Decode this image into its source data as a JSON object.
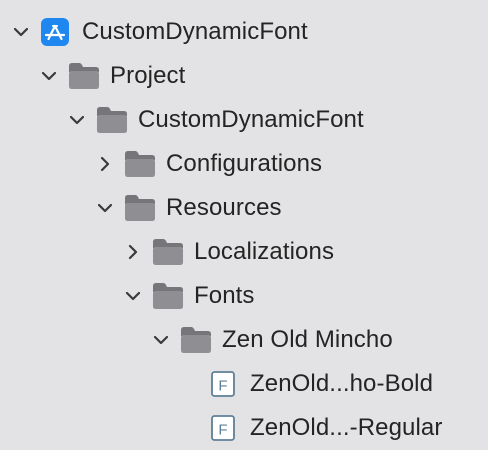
{
  "navigator": {
    "colors": {
      "folder": "#8e8e93",
      "folder_tab": "#75757a",
      "app_icon": "#1e87f0",
      "file_icon": "#5e7f96",
      "chevron": "#3a3a3c",
      "text": "#242424",
      "background": "#e3e3e5"
    },
    "items": [
      {
        "label": "CustomDynamicFont",
        "icon": "app-project-icon",
        "expanded": true
      },
      {
        "label": "Project",
        "icon": "folder-icon",
        "expanded": true
      },
      {
        "label": "CustomDynamicFont",
        "icon": "folder-icon",
        "expanded": true
      },
      {
        "label": "Configurations",
        "icon": "folder-icon",
        "expanded": false
      },
      {
        "label": "Resources",
        "icon": "folder-icon",
        "expanded": true
      },
      {
        "label": "Localizations",
        "icon": "folder-icon",
        "expanded": false
      },
      {
        "label": "Fonts",
        "icon": "folder-icon",
        "expanded": true
      },
      {
        "label": "Zen Old Mincho",
        "icon": "folder-icon",
        "expanded": true
      },
      {
        "label": "ZenOld...ho-Bold",
        "icon": "font-file-icon",
        "badge": "F"
      },
      {
        "label": "ZenOld...-Regular",
        "icon": "font-file-icon",
        "badge": "F"
      }
    ]
  }
}
